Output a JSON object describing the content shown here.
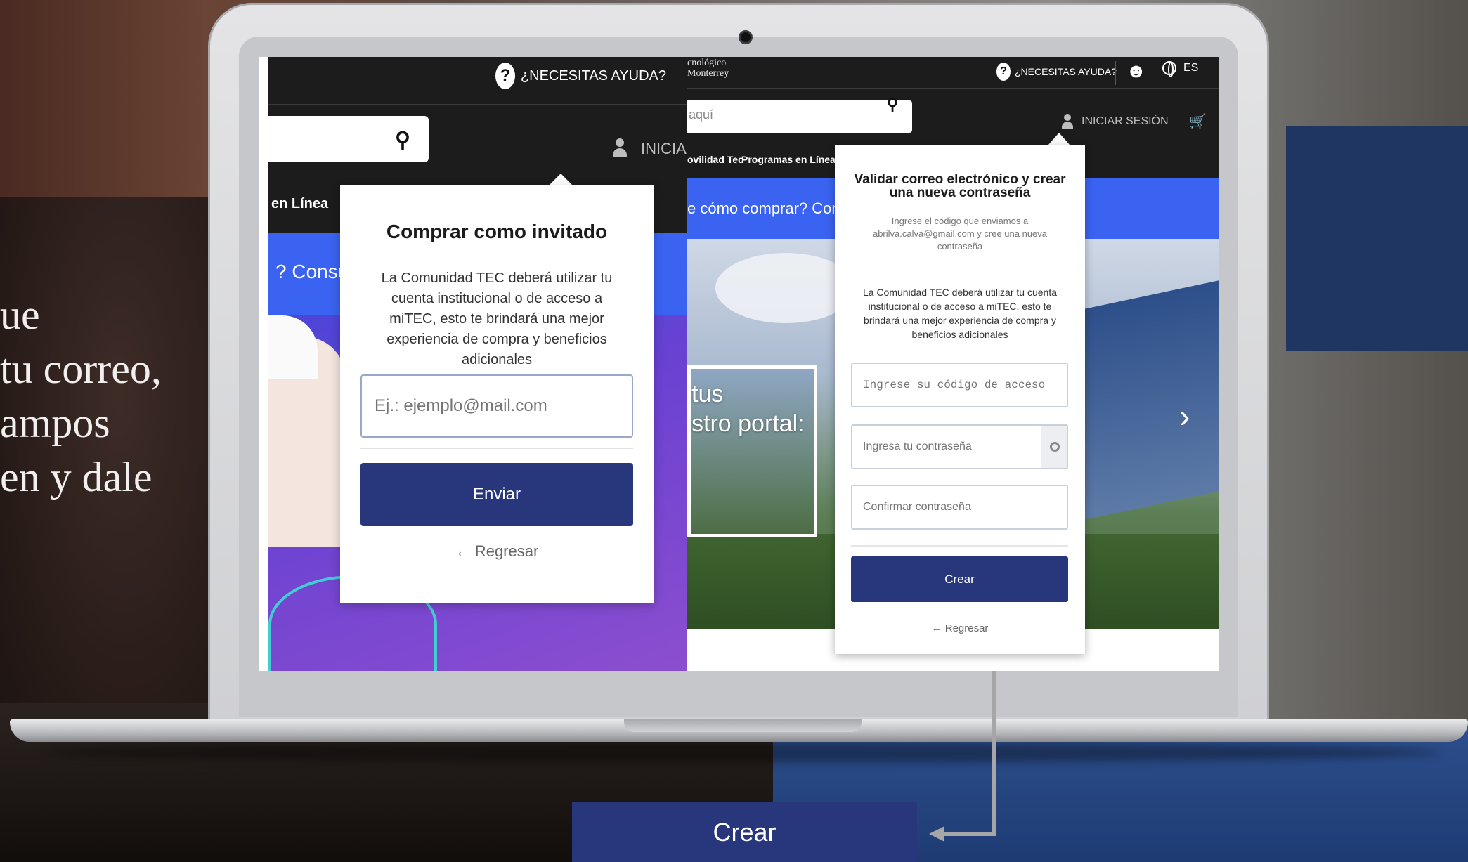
{
  "side_text": {
    "line1": "ue",
    "line2": "tu correo,",
    "line3": "ampos",
    "line4": "en y dale"
  },
  "left_panel": {
    "help": "¿NECESITAS AYUDA?",
    "help_icon": "?",
    "search_icon": "search-icon",
    "login_partial": "INICIAR",
    "nav_partial": "en Línea",
    "banner_partial": "? Consult",
    "popover": {
      "title": "Comprar como invitado",
      "description": "La Comunidad TEC deberá utilizar tu cuenta institucional o de acceso a miTEC, esto te brindará una mejor experiencia de compra y beneficios adicionales",
      "email_placeholder": "Ej.: ejemplo@mail.com",
      "submit_label": "Enviar",
      "back_label": "← Regresar"
    }
  },
  "right_panel": {
    "logo_line1": "cnológico",
    "logo_line2": "Monterrey",
    "help": "¿NECESITAS AYUDA?",
    "help_icon": "?",
    "smile_glyph": "☻",
    "lang": "ES",
    "search_partial": "aquí",
    "login": "INICIAR SESIÓN",
    "cart_glyph": "🛒",
    "nav_items": [
      "ovilidad Tec",
      "Programas en Línea"
    ],
    "banner_partial": "e cómo comprar? Consult",
    "hero_line1": "tus",
    "hero_line2": "stro portal:",
    "chevron": "›",
    "card": {
      "title": "Validar correo electrónico y crear una nueva contraseña",
      "subtitle": "Ingrese el código que enviamos a abrilva.calva@gmail.com y cree una nueva contraseña",
      "description": "La Comunidad TEC deberá utilizar tu cuenta institucional o de acceso a miTEC, esto te brindará una mejor experiencia de compra y beneficios adicionales",
      "code_placeholder": "Ingrese su código de acceso",
      "password_placeholder": "Ingresa tu contraseña",
      "confirm_placeholder": "Confirmar contraseña",
      "create_label": "Crear",
      "back_label": "← Regresar"
    }
  },
  "callout": {
    "button_label": "Crear"
  },
  "colors": {
    "primary_button": "#28367c",
    "topbar": "#1c1c1c",
    "banner_blue": "#3b63f2"
  }
}
